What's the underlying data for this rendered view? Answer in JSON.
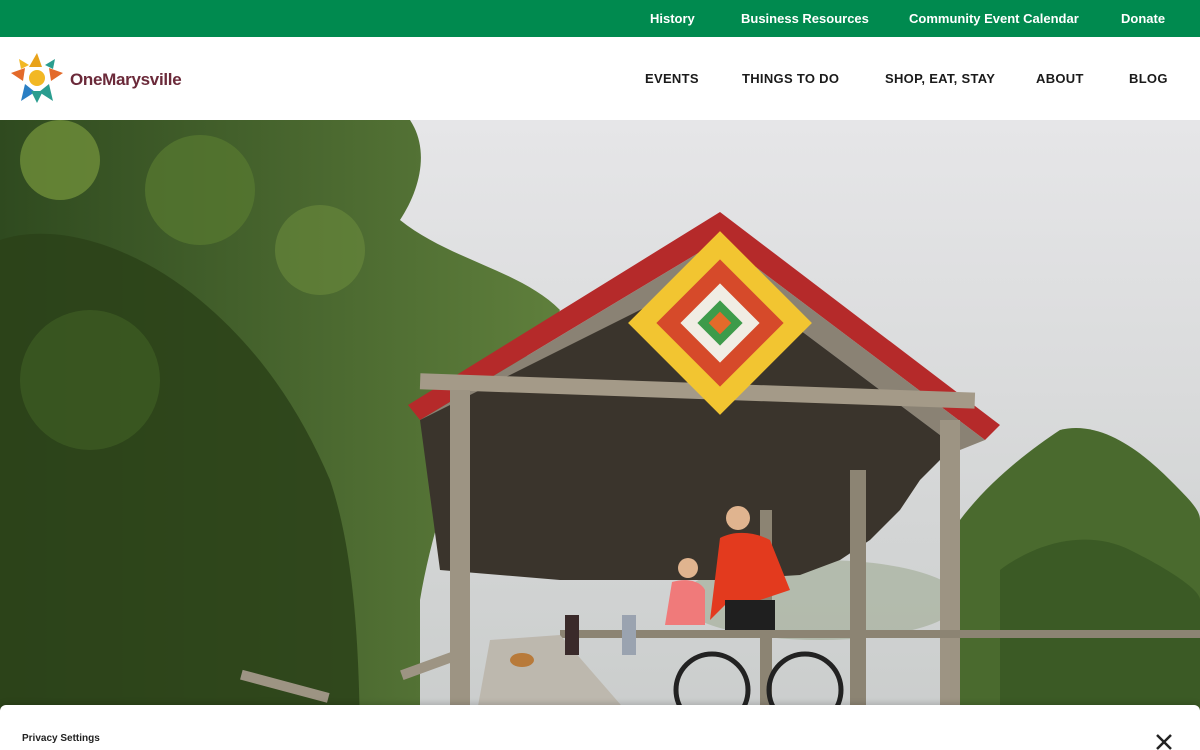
{
  "topbar": {
    "links": [
      "History",
      "Business Resources",
      "Community Event Calendar",
      "Donate"
    ]
  },
  "header": {
    "logo_text": "OneMarysville",
    "nav": [
      "EVENTS",
      "THINGS TO DO",
      "SHOP, EAT, STAY",
      "ABOUT",
      "BLOG"
    ]
  },
  "hero": {
    "image_subject": "covered-bridge-with-barn-quilt-and-cyclists"
  },
  "privacy": {
    "label": "Privacy Settings",
    "close_icon": "close-icon"
  },
  "colors": {
    "topbar": "#008a4f",
    "logo_text": "#6b2a3a",
    "roof_red": "#b52a2a"
  }
}
